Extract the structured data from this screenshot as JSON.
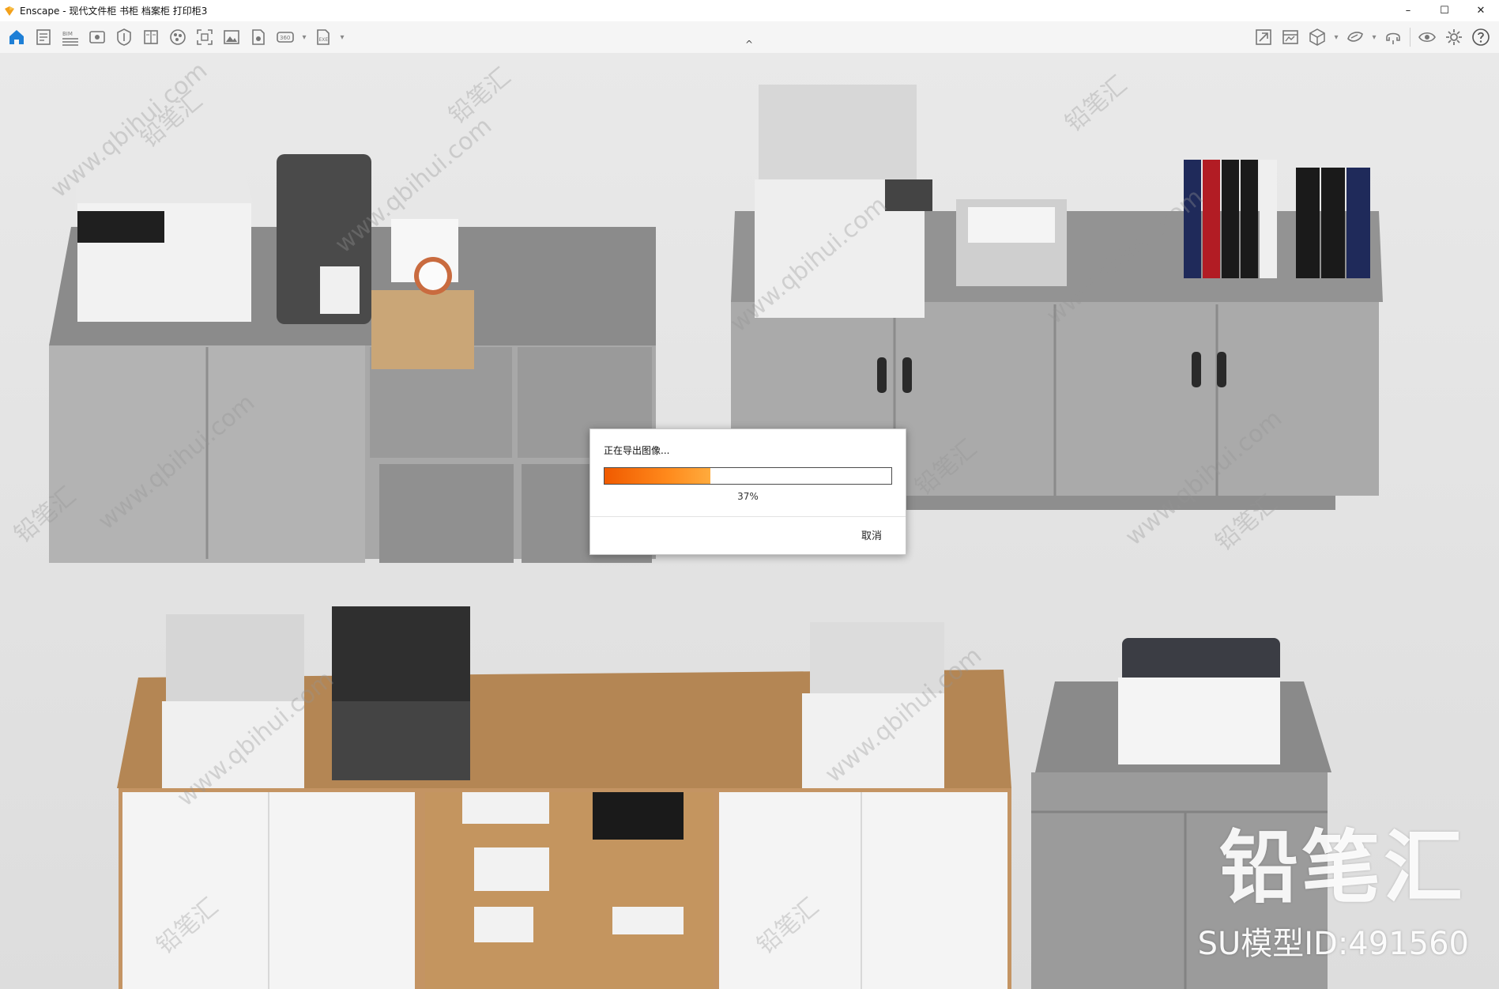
{
  "window": {
    "app_name": "Enscape",
    "title": "Enscape - 现代文件柜 书柜 档案柜 打印柜3",
    "minimize": "–",
    "maximize": "☐",
    "close": "✕"
  },
  "toolbar": {
    "left_tools": [
      {
        "name": "home-icon"
      },
      {
        "name": "project-info-icon"
      },
      {
        "name": "bim-icon",
        "text": "BIM"
      },
      {
        "name": "views-icon"
      },
      {
        "name": "asset-library-icon"
      },
      {
        "name": "manual-icon"
      },
      {
        "name": "material-editor-icon"
      },
      {
        "name": "capture-icon"
      },
      {
        "name": "render-image-icon"
      },
      {
        "name": "batch-render-icon"
      },
      {
        "name": "panorama-icon",
        "text": "360"
      },
      {
        "name": "export-exe-icon",
        "text": "EXE"
      }
    ],
    "right_tools": [
      {
        "name": "upload-icon"
      },
      {
        "name": "web-standalone-icon"
      },
      {
        "name": "cube-icon"
      },
      {
        "name": "vr-headset-icon"
      },
      {
        "name": "feedback-icon"
      },
      {
        "name": "visual-settings-icon"
      },
      {
        "name": "settings-icon"
      },
      {
        "name": "help-icon"
      }
    ],
    "collapse_caret": "^"
  },
  "dialog": {
    "message": "正在导出图像...",
    "progress": 0.37,
    "percent_text": "37%",
    "cancel_label": "取消",
    "fill_color": "#f36a0d"
  },
  "watermark": {
    "repeat_text": "www.qbihui.com",
    "repeat_text_cn": "铅笔汇",
    "brand": "铅笔汇",
    "model_id": "SU模型ID:491560"
  }
}
